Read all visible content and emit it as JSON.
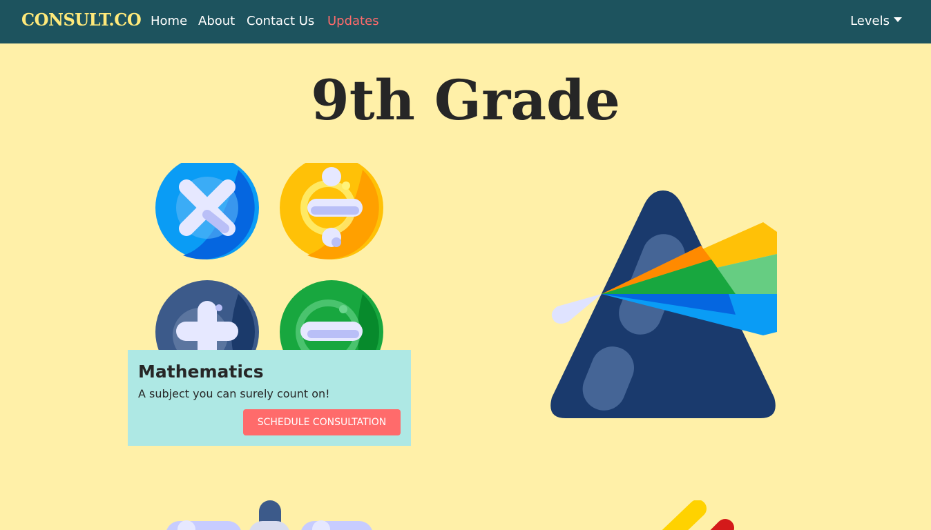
{
  "navbar": {
    "brand": "CONSULT.CO",
    "links": [
      {
        "label": "Home",
        "active": false
      },
      {
        "label": "About",
        "active": false
      },
      {
        "label": "Contact Us",
        "active": false
      },
      {
        "label": "Updates",
        "active": true
      }
    ],
    "levels_label": "Levels"
  },
  "page": {
    "title": "9th Grade"
  },
  "card": {
    "title": "Mathematics",
    "text": "A subject you can surely count on!",
    "button_label": "SCHEDULE CONSULTATION"
  },
  "colors": {
    "navbar": "#1d535e",
    "brand": "#ffe97a",
    "active_link": "#ff6b6b",
    "background": "#fff0a8",
    "card": "#aee8e4",
    "button": "#ff6b6b"
  },
  "icons": [
    "multiply-icon",
    "divide-icon",
    "plus-icon",
    "equals-icon",
    "prism-icon",
    "math-symbols-icon",
    "pencil-icon"
  ]
}
